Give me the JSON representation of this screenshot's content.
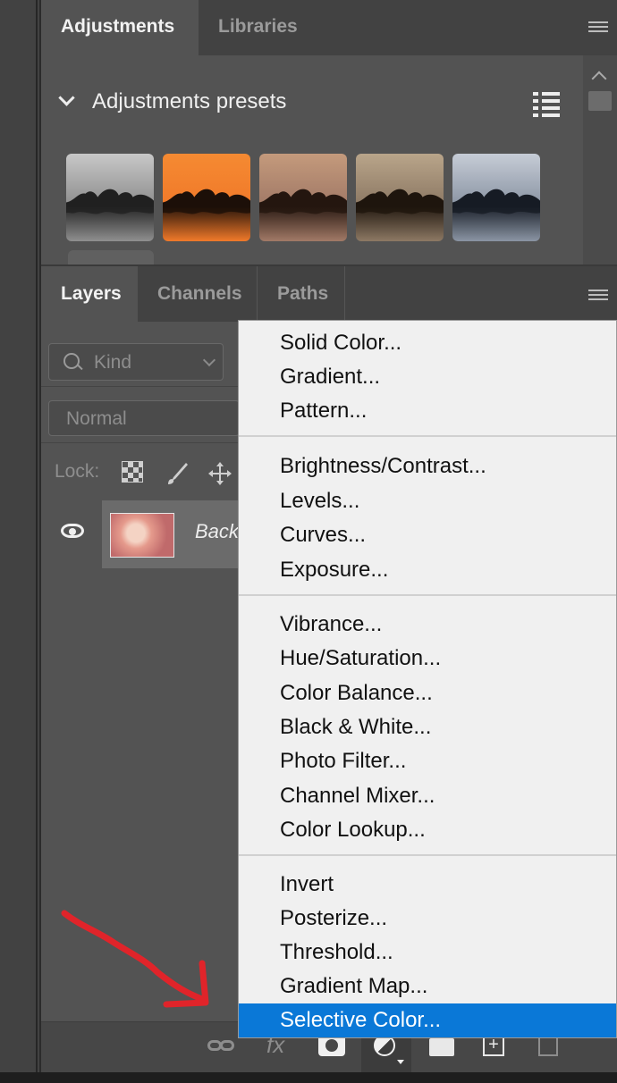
{
  "adjustments_panel": {
    "tabs": [
      "Adjustments",
      "Libraries"
    ],
    "section_title": "Adjustments presets",
    "presets": [
      {
        "name": "preset-grayscale",
        "sky": "#c8c8c8",
        "water": "#8f8f8f",
        "tint": "#202020"
      },
      {
        "name": "preset-sunset",
        "sky": "#f58a32",
        "water": "#f17a2a",
        "tint": "#1c0f08"
      },
      {
        "name": "preset-dusk",
        "sky": "#c49a7c",
        "water": "#a27a67",
        "tint": "#24160f"
      },
      {
        "name": "preset-sepia",
        "sky": "#b9a58a",
        "water": "#8d7964",
        "tint": "#1e150d"
      },
      {
        "name": "preset-cool",
        "sky": "#c6ccd6",
        "water": "#8b95a4",
        "tint": "#161b24"
      }
    ]
  },
  "layers_panel": {
    "tabs": [
      "Layers",
      "Channels",
      "Paths"
    ],
    "filter_kind": "Kind",
    "blend_mode": "Normal",
    "lock_label": "Lock:",
    "layer": {
      "name": "Back"
    }
  },
  "adjustment_menu": {
    "groups": [
      [
        "Solid Color...",
        "Gradient...",
        "Pattern..."
      ],
      [
        "Brightness/Contrast...",
        "Levels...",
        "Curves...",
        "Exposure..."
      ],
      [
        "Vibrance...",
        "Hue/Saturation...",
        "Color Balance...",
        "Black & White...",
        "Photo Filter...",
        "Channel Mixer...",
        "Color Lookup..."
      ],
      [
        "Invert",
        "Posterize...",
        "Threshold...",
        "Gradient Map...",
        "Selective Color..."
      ]
    ],
    "selected": "Selective Color..."
  },
  "colors": {
    "highlight": "#0a78d7",
    "annotation_arrow": "#e0242a"
  }
}
